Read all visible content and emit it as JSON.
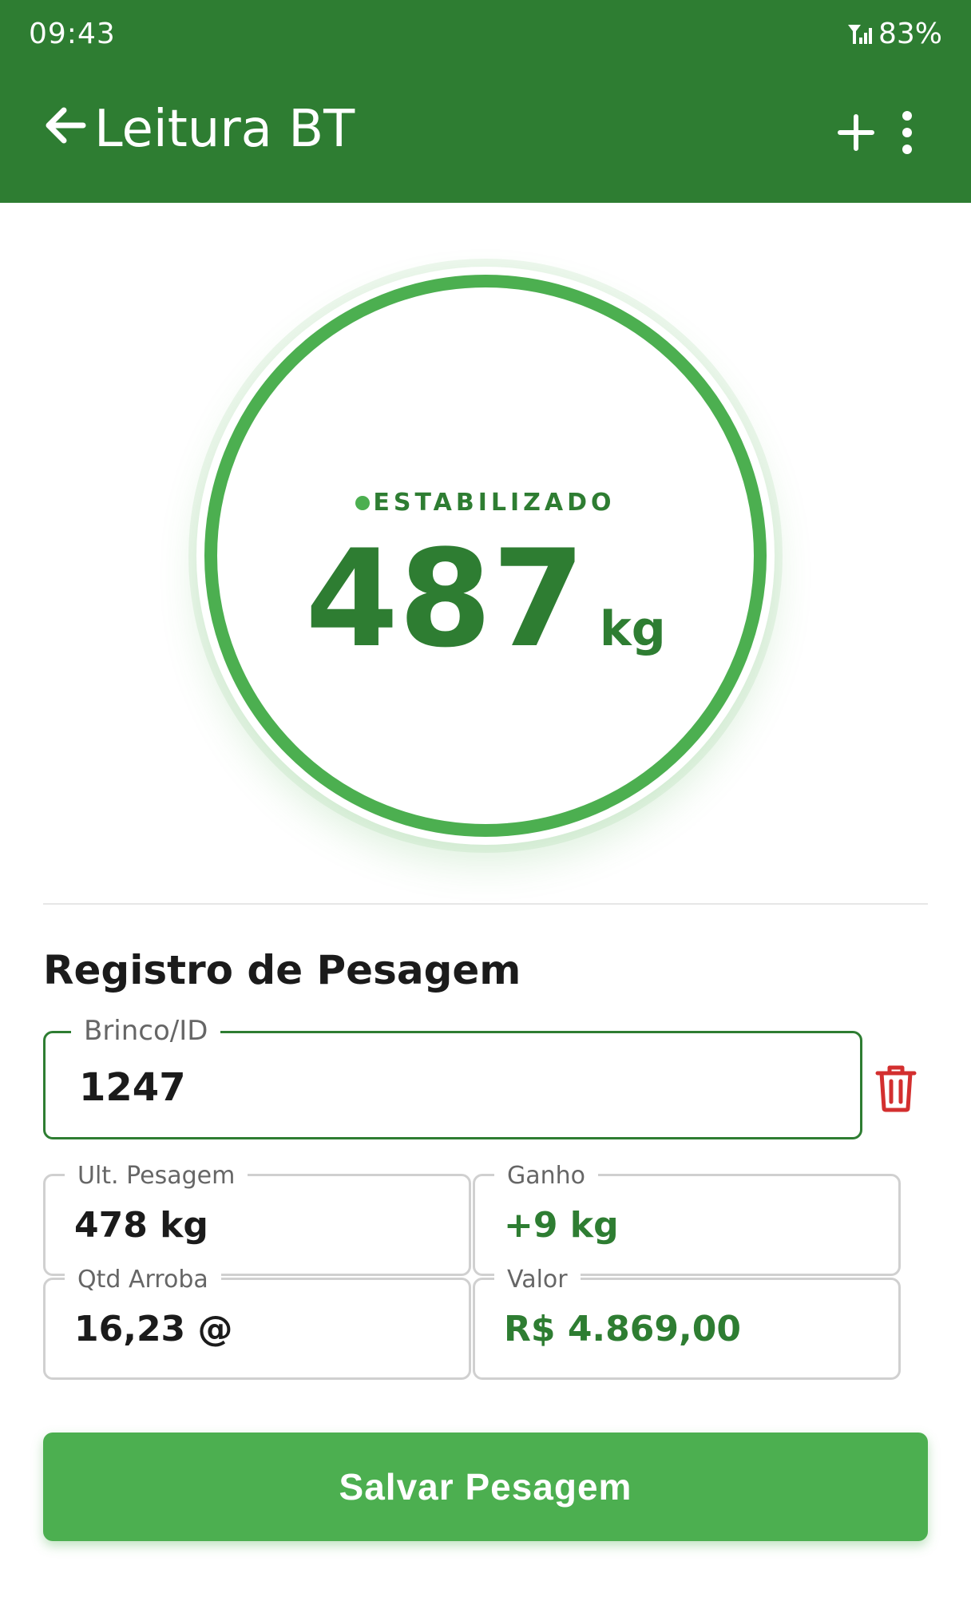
{
  "status_bar": {
    "time": "09:43",
    "battery": "83%",
    "signal_icon": "signal-icon"
  },
  "app_bar": {
    "title": "Leitura BT",
    "back_icon": "arrow-left-icon",
    "add_icon": "plus-icon",
    "menu_icon": "more-vertical-icon"
  },
  "scale": {
    "status": "ESTABILIZADO",
    "weight": "487",
    "unit": "kg"
  },
  "form": {
    "title": "Registro de Pesagem",
    "id_field": {
      "label": "Brinco/ID",
      "value": "1247"
    },
    "delete_icon": "trash-icon",
    "last_weight": {
      "label": "Ult. Pesagem",
      "value": "478 kg"
    },
    "gain": {
      "label": "Ganho",
      "value": "+9 kg"
    },
    "arroba_qty": {
      "label": "Qtd Arroba",
      "value": "16,23 @"
    },
    "price": {
      "label": "Valor",
      "value": "R$ 4.869,00"
    }
  },
  "actions": {
    "save_label": "Salvar Pesagem"
  },
  "colors": {
    "primary_dark": "#2e7d32",
    "primary": "#4caf50",
    "danger": "#d32f2f"
  }
}
